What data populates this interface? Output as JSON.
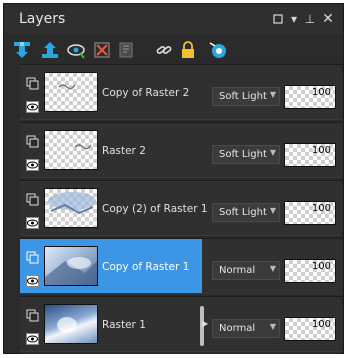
{
  "panel": {
    "title": "Layers",
    "title_buttons": [
      "square-icon",
      "dropdown-icon",
      "pin-icon",
      "close-icon"
    ]
  },
  "toolbar": {
    "tools": [
      "new-raster-layer-icon",
      "new-vector-layer-icon",
      "visibility-toggle-icon",
      "delete-layer-icon",
      "layer-properties-icon",
      "link-icon",
      "lock-icon",
      "mask-icon"
    ]
  },
  "layers": [
    {
      "name": "Copy of Raster 2",
      "blend": "Soft Light",
      "opacity": "100",
      "selected": false
    },
    {
      "name": "Raster 2",
      "blend": "Soft Light",
      "opacity": "100",
      "selected": false
    },
    {
      "name": "Copy (2) of Raster 1",
      "blend": "Soft Light",
      "opacity": "100",
      "selected": false
    },
    {
      "name": "Copy of Raster 1",
      "blend": "Normal",
      "opacity": "100",
      "selected": true
    },
    {
      "name": "Raster 1",
      "blend": "Normal",
      "opacity": "100",
      "selected": false
    }
  ],
  "colors": {
    "panel_bg": "#2b2b2b",
    "selection": "#3d95e6",
    "toolbar_accent": "#2aa6e0"
  }
}
